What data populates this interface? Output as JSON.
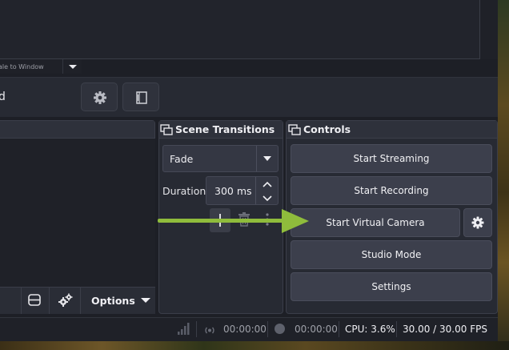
{
  "preview": {
    "scale_label": "ale to Window"
  },
  "toolbar": {
    "scene_name": "d"
  },
  "transitions": {
    "title": "Scene Transitions",
    "transition_value": "Fade",
    "duration_label": "Duration",
    "duration_value": "300 ms"
  },
  "sources": {
    "options_label": "Options"
  },
  "controls": {
    "title": "Controls",
    "buttons": [
      "Start Streaming",
      "Start Recording",
      "Start Virtual Camera",
      "Studio Mode",
      "Settings"
    ]
  },
  "status": {
    "stream_time": "00:00:00",
    "record_time": "00:00:00",
    "cpu": "CPU: 3.6%",
    "fps": "30.00 / 30.00 FPS"
  },
  "colors": {
    "annotation_arrow": "#8fbc3c",
    "panel_bg": "#272a33",
    "button_bg": "#3c3f4c"
  }
}
